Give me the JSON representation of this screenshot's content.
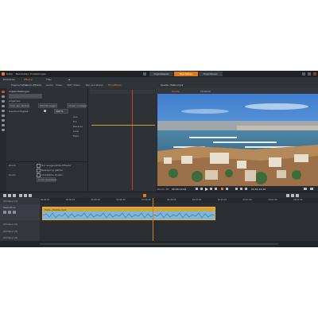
{
  "menu": {
    "app_icon": "app-logo-icon",
    "items": [
      "Datei",
      "Bearbeiten",
      "Einstellungen"
    ]
  },
  "modes": [
    {
      "label": "Organisieren",
      "active": false
    },
    {
      "label": "Bearbeiten",
      "active": true
    },
    {
      "label": "Exportieren",
      "active": false
    }
  ],
  "library_tabs": [
    "Bibliothek",
    "Effekte",
    "Titel"
  ],
  "effect_tabs": [
    "Eigenschaften",
    "Audio-Effekte",
    "Audio",
    "Video",
    "360° Video",
    "Pan und Zoom",
    "Filmeffekte"
  ],
  "left_panel": {
    "section": "Clipeinstellungen",
    "subsection": "Allgemein",
    "buttons": [
      "Clip neu starten",
      "Schnitt zeigen",
      "Linear anzeigen"
    ],
    "value_label": "Geschwindigkeit",
    "value": "100 %",
    "list": [
      "Aus",
      "Ein",
      "Reverse",
      "Loop",
      "Fade"
    ],
    "checkbox_section": "Zoom",
    "checkbox_options": [
      "Nur ausgewählte Effekte",
      "Bewegung glätten"
    ],
    "audio_label": "Audio",
    "audio_checkbox": "Lautstärke ändern",
    "audio_button": "Audio anpassen"
  },
  "preview": {
    "header": "Quelle: Hafen.mp4",
    "tabs": [
      "Quelle",
      "Timeline"
    ],
    "timecode_left": "00:00:12:04",
    "timecode_right": "00:01:24:18",
    "zoom": "Zoom: Fit"
  },
  "timeline": {
    "tracks": [
      {
        "name": "A/V-Spur (1)"
      },
      {
        "name": "Mediathek"
      },
      {
        "name": "A/V-Spur (2)"
      },
      {
        "name": "A/V-Spur (3)"
      },
      {
        "name": "A/V-Spur (4)"
      }
    ],
    "clip_name": "Hafen_Palma.mp4",
    "ruler_marks": [
      "00:00:00",
      "00:00:10",
      "00:00:20",
      "00:00:30",
      "00:00:40",
      "00:00:50",
      "00:01:00",
      "00:01:10",
      "00:01:20",
      "00:01:30",
      "00:01:40"
    ],
    "playhead_fraction": 0.4
  },
  "colors": {
    "accent": "#e07a1f",
    "clip_video": "#d4a33a",
    "clip_audio": "#7db6dc",
    "background": "#2a2d31"
  }
}
